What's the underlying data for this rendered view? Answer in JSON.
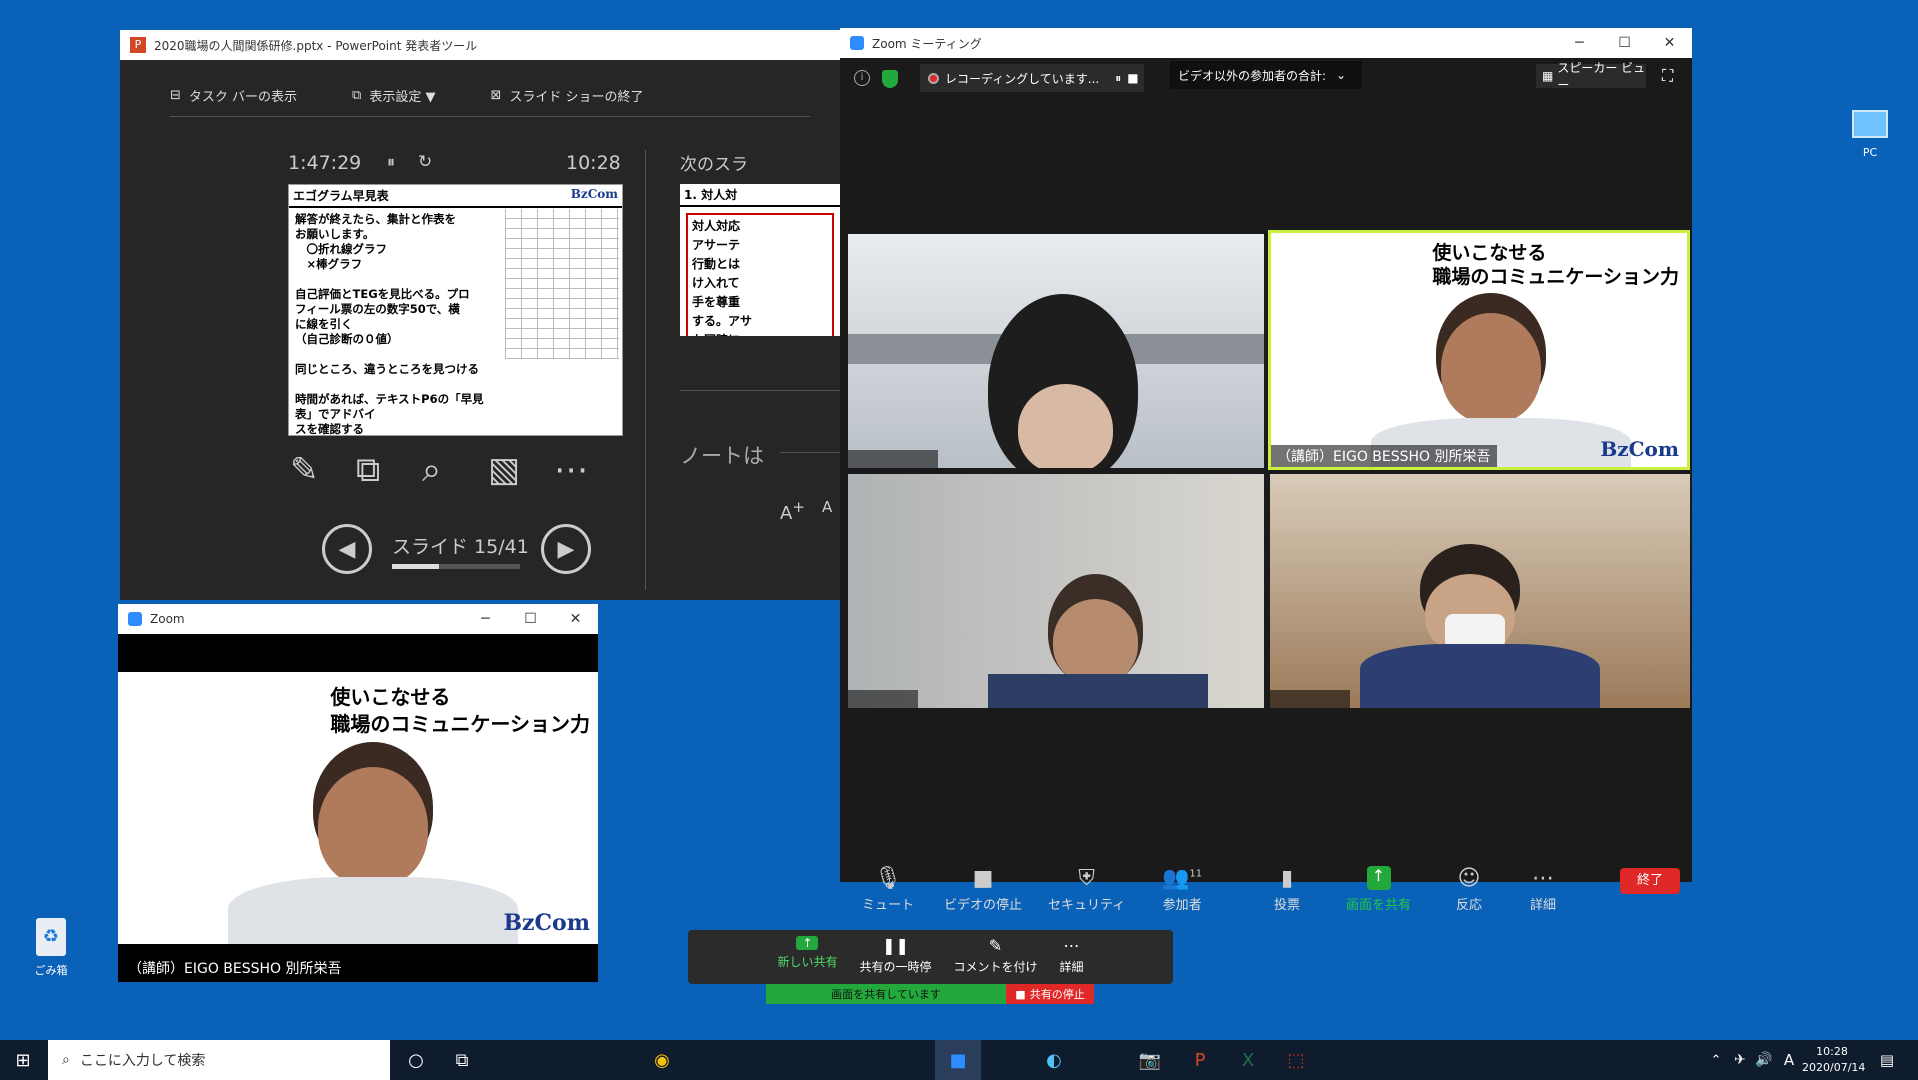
{
  "ppt": {
    "title": "2020職場の人間関係研修.pptx - PowerPoint 発表者ツール",
    "toolbar": [
      "タスク バーの表示",
      "表示設定 ▼",
      "スライド ショーの終了"
    ],
    "elapsed": "1:47:29",
    "clock": "10:28",
    "next_label": "次のスラ",
    "notes_label": "ノートは",
    "slide_counter": "スライド 15/41",
    "progress": 0.366,
    "slide": {
      "title": "エゴグラム早見表",
      "logo": "BzCom",
      "lines": [
        "解答が終えたら、集計と作表を",
        "お願いします。",
        "　〇折れ線グラフ",
        "　×棒グラフ",
        "",
        "自己評価とTEGを見比べる。プロ",
        "フィール票の左の数字50で、横",
        "に線を引く",
        "（自己診断の０値）",
        "",
        "同じところ、違うところを見つける",
        "",
        "時間があれば、テキストP6の「早見表」でアドバイ",
        "スを確認する"
      ]
    },
    "next_slide": {
      "title": "1. 対人対",
      "lines": [
        "対人対応",
        "アサーテ",
        "行動とは",
        "け入れて",
        "手を尊重",
        "する。アサ",
        "も同時に"
      ]
    }
  },
  "zoom": {
    "title": "Zoom ミーティング",
    "recording": "レコーディングしています...",
    "participants_total": "ビデオ以外の参加者の合計:",
    "speaker_view": "スピーカー ビュー",
    "presenter_name": "（講師）EIGO BESSHO 別所栄吾",
    "slide_line1": "使いこなせる",
    "slide_line2": "職場のコミュニケーション力",
    "logo": "BzCom",
    "controls": [
      "ミュート",
      "ビデオの停止",
      "セキュリティ",
      "参加者",
      "投票",
      "画面を共有",
      "反応",
      "詳細"
    ],
    "participant_count": "11",
    "end_label": "終了"
  },
  "zoom_small": {
    "title": "Zoom",
    "name": "（講師）EIGO BESSHO 別所栄吾",
    "slide_line1": "使いこなせる",
    "slide_line2": "職場のコミュニケーション力",
    "logo": "BzCom"
  },
  "share": {
    "buttons": [
      "新しい共有",
      "共有の一時停",
      "コメントを付け",
      "詳細"
    ],
    "status": "画面を共有しています",
    "stop": "共有の停止"
  },
  "desktop": {
    "pc_label": "PC",
    "recycle_label": "ごみ箱"
  },
  "taskbar": {
    "search_placeholder": "ここに入力して検索",
    "time": "10:28",
    "date": "2020/07/14",
    "ime": "A"
  },
  "colors": {
    "desktop": "#0a62b8",
    "zoom_green": "#23a83b",
    "end_red": "#e02828",
    "highlight": "#c8f03c"
  }
}
